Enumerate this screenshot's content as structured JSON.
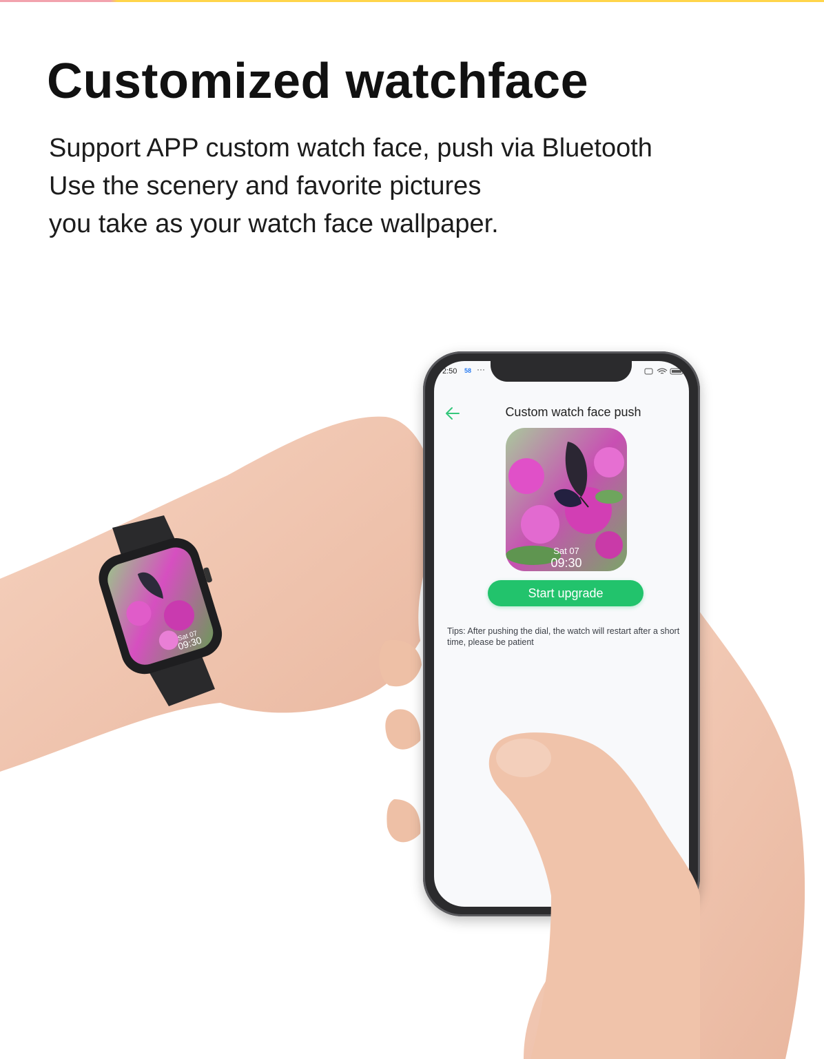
{
  "headline": "Customized watchface",
  "description": [
    "Support APP custom watch face, push via Bluetooth",
    "Use the scenery and favorite pictures",
    "you take as your watch face wallpaper."
  ],
  "watch": {
    "date": "Sat 07",
    "time": "09:30"
  },
  "phone": {
    "status_time": "2:50",
    "status_badge": "58",
    "status_dots": "···",
    "app_title": "Custom watch face push",
    "preview": {
      "date": "Sat 07",
      "time": "09:30"
    },
    "upgrade_button": "Start upgrade",
    "tips": "Tips: After pushing the dial, the watch will restart after a short time, please be patient"
  },
  "colors": {
    "accent_green": "#22c36c",
    "back_arrow": "#34c77b",
    "flower_magenta": "#d63bb8"
  },
  "icons": [
    "back-arrow-icon",
    "wifi-icon",
    "battery-icon",
    "close-box-icon"
  ]
}
